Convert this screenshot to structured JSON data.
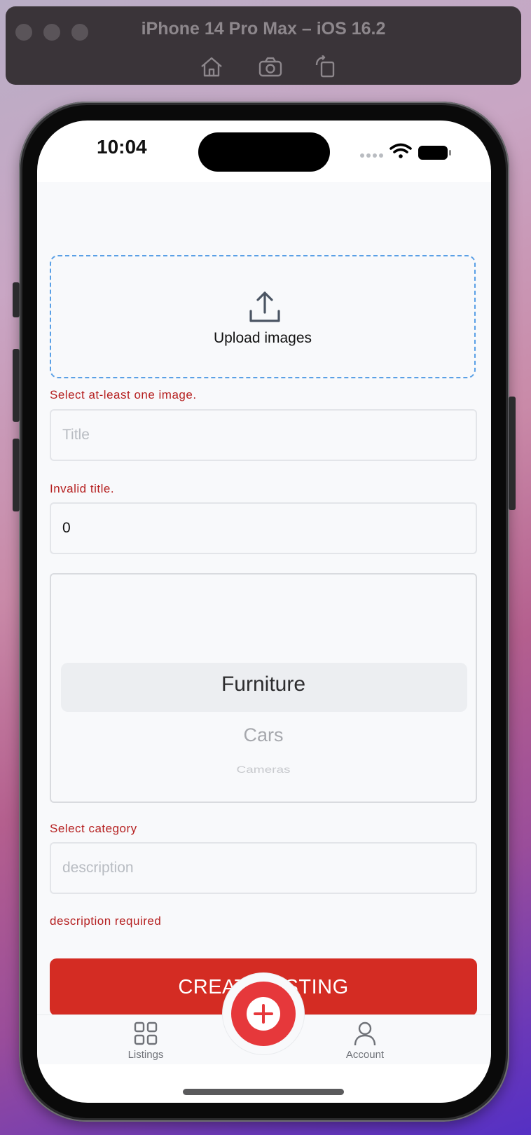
{
  "simulator": {
    "title": "iPhone 14 Pro Max – iOS 16.2",
    "toolbar_icons": [
      "home-icon",
      "screenshot-icon",
      "rotate-icon"
    ]
  },
  "status_bar": {
    "time": "10:04",
    "icons": [
      "cellular-dots-icon",
      "wifi-icon",
      "battery-icon"
    ]
  },
  "form": {
    "upload": {
      "label": "Upload images",
      "icon": "upload-icon",
      "error": "Select at-least one image."
    },
    "title": {
      "value": "",
      "placeholder": "Title",
      "error": "Invalid title."
    },
    "price": {
      "value": "0",
      "placeholder": ""
    },
    "category": {
      "selected": "Furniture",
      "visible_options": [
        "Furniture",
        "Cars",
        "Cameras"
      ],
      "error": "Select category"
    },
    "description": {
      "value": "",
      "placeholder": "description",
      "error": "description required"
    },
    "submit_label": "CREATE LISTING"
  },
  "tab_bar": {
    "tabs": [
      {
        "label": "Listings",
        "icon": "grid-icon"
      },
      {
        "label": "Account",
        "icon": "person-icon"
      }
    ],
    "center_icon": "plus-circle-icon"
  },
  "colors": {
    "accent_red": "#d42c23",
    "fab_red": "#e6383b",
    "error_red": "#b51f1f",
    "dashed_blue": "#5aa0e6"
  }
}
